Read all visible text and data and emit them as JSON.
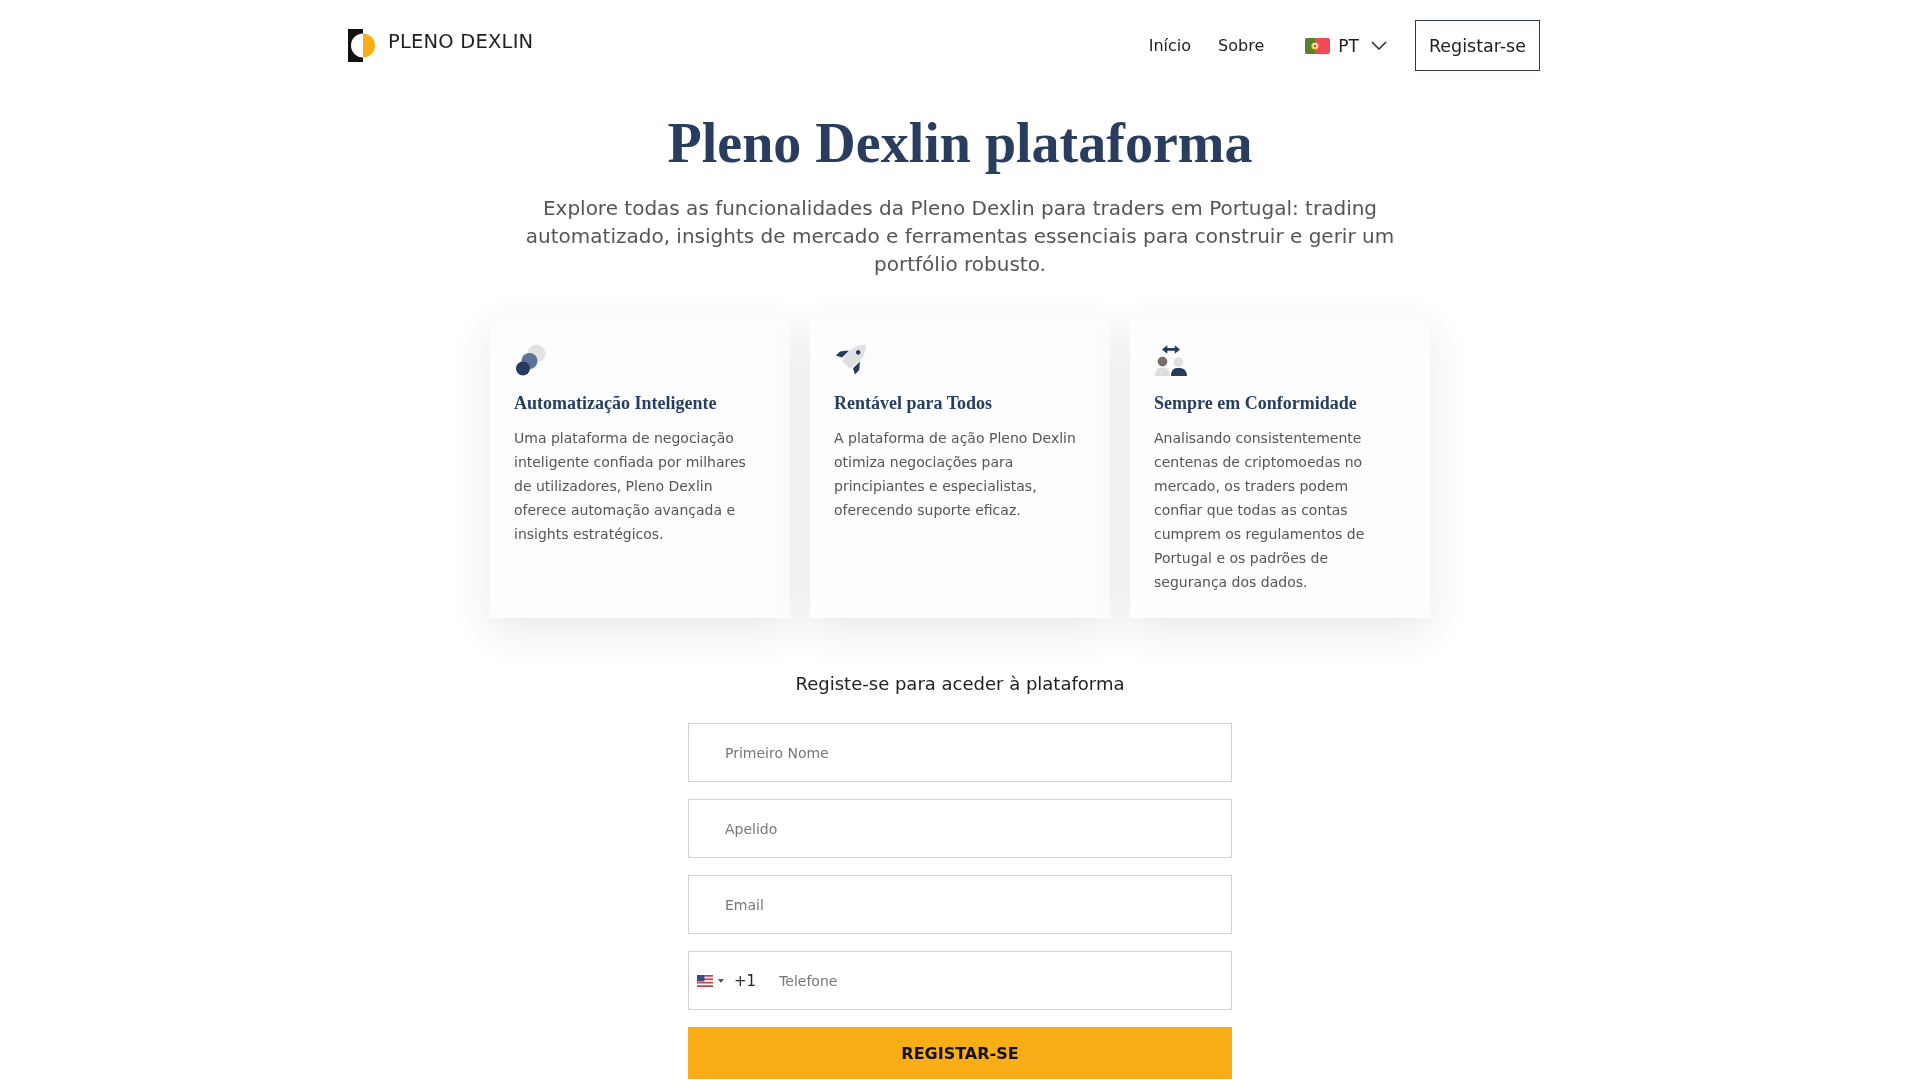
{
  "header": {
    "logo": {
      "text": "PLENO DEXLIN"
    },
    "nav": [
      {
        "label": "Início"
      },
      {
        "label": "Sobre"
      }
    ],
    "language": {
      "code": "PT"
    },
    "cta": {
      "label": "Registar-se"
    }
  },
  "hero": {
    "title": "Pleno Dexlin plataforma",
    "subtitle": "Explore todas as funcionalidades da Pleno Dexlin para traders em Portugal: trading automatizado, insights de mercado e ferramentas essenciais para construir e gerir um portfólio robusto."
  },
  "features": [
    {
      "title": "Automatização Inteligente",
      "text": "Uma plataforma de negociação inteligente confiada por milhares de utilizadores, Pleno Dexlin oferece automação avançada e insights estratégicos."
    },
    {
      "title": "Rentável para Todos",
      "text": "A plataforma de ação Pleno Dexlin otimiza negociações para principiantes e especialistas, oferecendo suporte eficaz."
    },
    {
      "title": "Sempre em Conformidade",
      "text": "Analisando consistentemente centenas de criptomoedas no mercado, os traders podem confiar que todas as contas cumprem os regulamentos de Portugal e os padrões de segurança dos dados."
    }
  ],
  "form": {
    "heading": "Registe-se para aceder à plataforma",
    "fields": [
      {
        "kind": "text",
        "placeholder": "Primeiro Nome"
      },
      {
        "kind": "text",
        "placeholder": "Apelido"
      },
      {
        "kind": "text",
        "placeholder": "Email"
      },
      {
        "kind": "phone",
        "dial_code": "+1",
        "placeholder": "Telefone"
      }
    ],
    "submit": {
      "label": "REGISTAR-SE"
    }
  }
}
